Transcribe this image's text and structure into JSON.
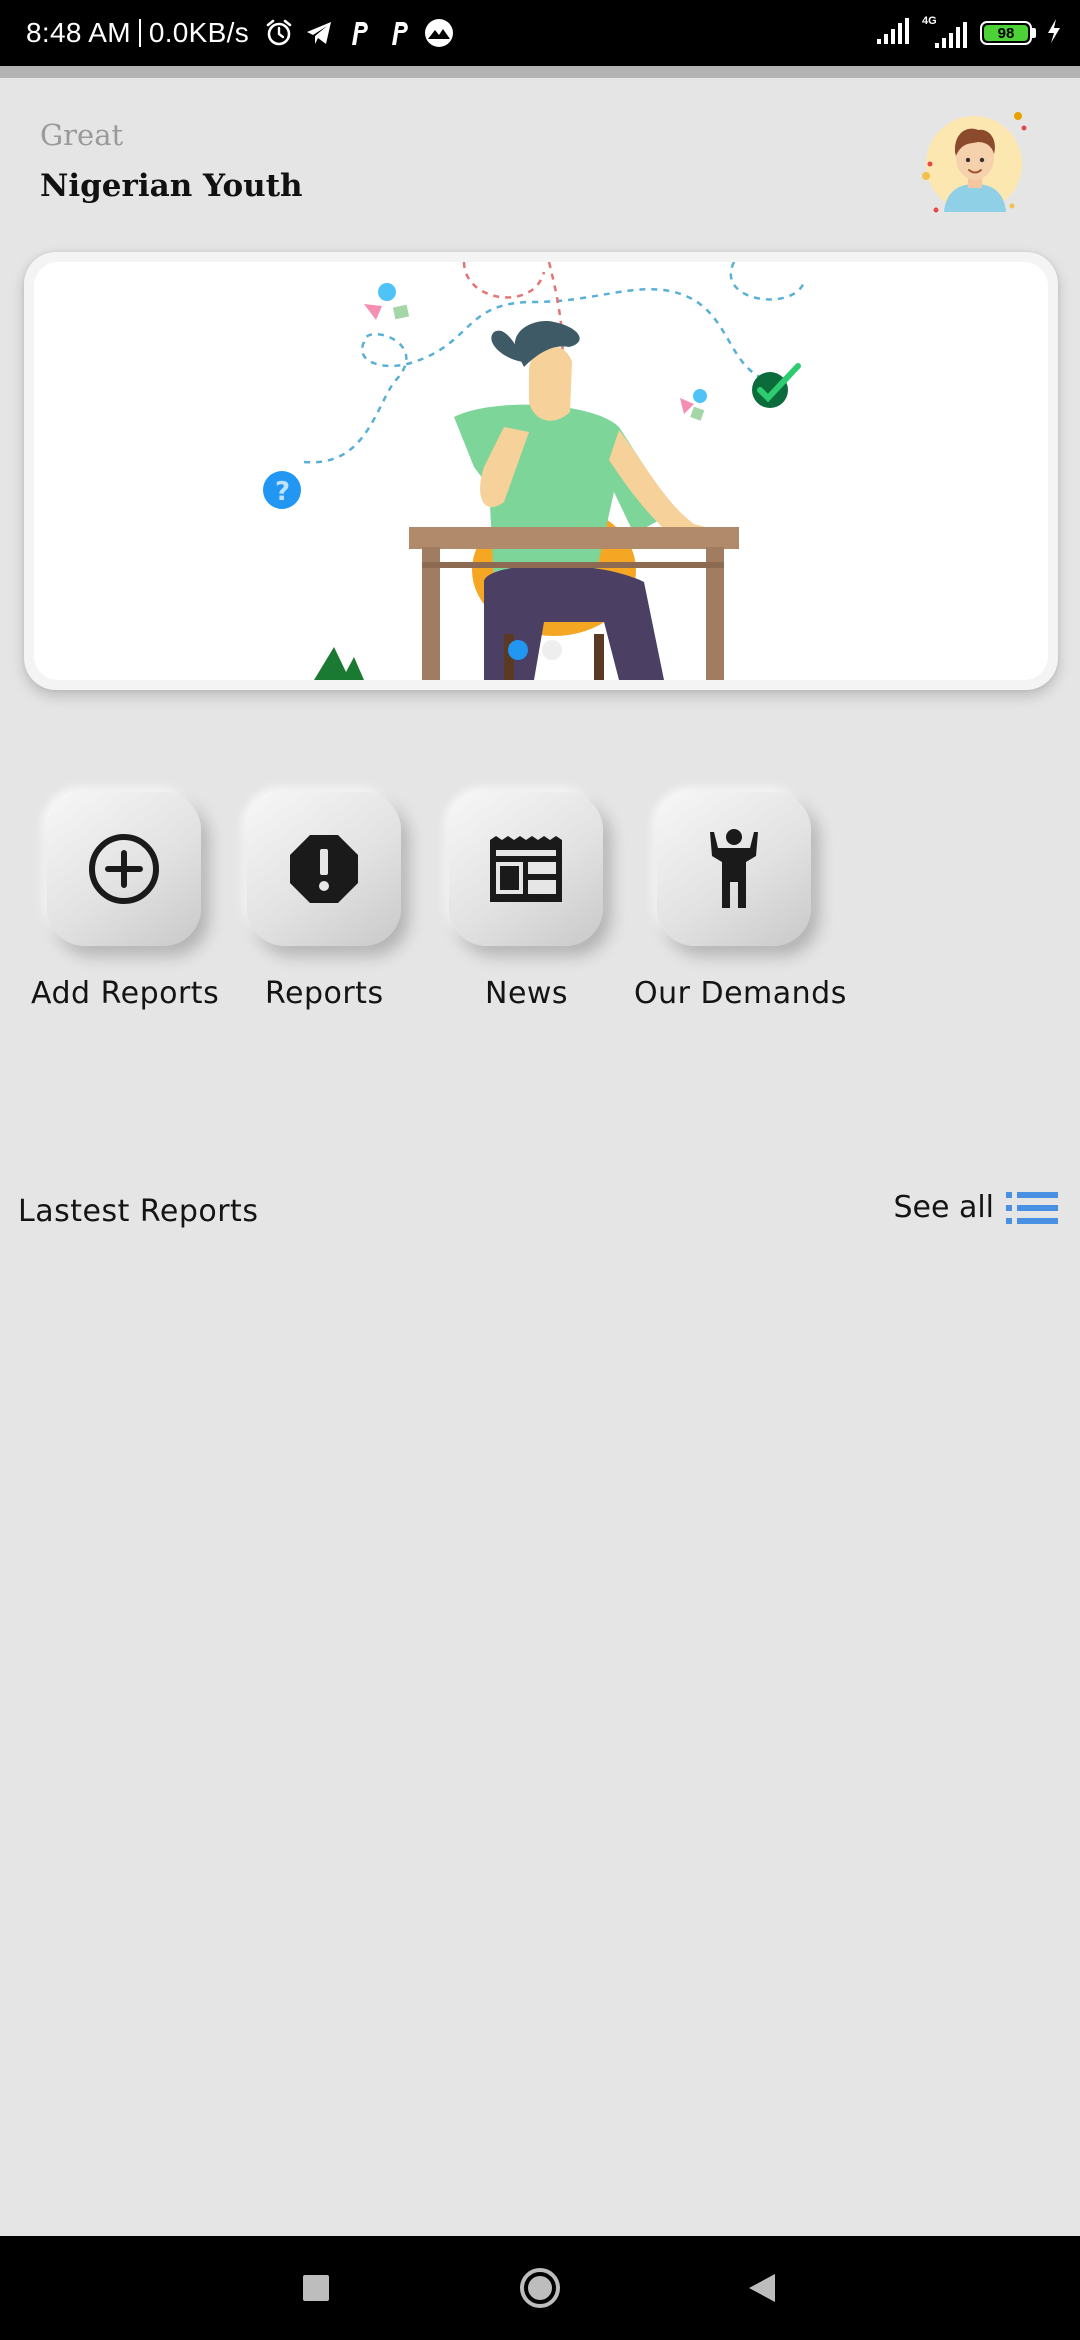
{
  "status_bar": {
    "time": "8:48 AM",
    "net_speed": "0.0KB/s",
    "network_type": "4G",
    "battery_level": "98",
    "battery_color": "#4cd137",
    "icons": [
      "alarm-icon",
      "telegram-icon",
      "p-app-icon",
      "p-app-icon",
      "mountain-app-icon",
      "signal-icon",
      "signal-4g-icon",
      "battery-icon",
      "charging-icon"
    ]
  },
  "header": {
    "greeting": "Great",
    "user_name": "Nigerian Youth",
    "avatar_icon": "user-avatar"
  },
  "banner": {
    "illustration": "person-thinking-at-desk",
    "slide_count": 2,
    "active_slide": 0,
    "active_dot_color": "#2196f3",
    "inactive_dot_color": "#eeeeee"
  },
  "actions": [
    {
      "label": "Add Reports",
      "icon": "add-circle-icon"
    },
    {
      "label": "Reports",
      "icon": "report-octagon-icon"
    },
    {
      "label": "News",
      "icon": "newspaper-icon"
    },
    {
      "label": "Our Demands",
      "icon": "person-raised-hand-icon"
    }
  ],
  "latest_reports": {
    "title": "Lastest Reports",
    "see_all_label": "See all",
    "list_icon": "list-icon",
    "list_icon_color": "#4a90e2",
    "items": []
  },
  "nav": {
    "buttons": [
      "recent-apps-button",
      "home-button",
      "back-button"
    ]
  }
}
